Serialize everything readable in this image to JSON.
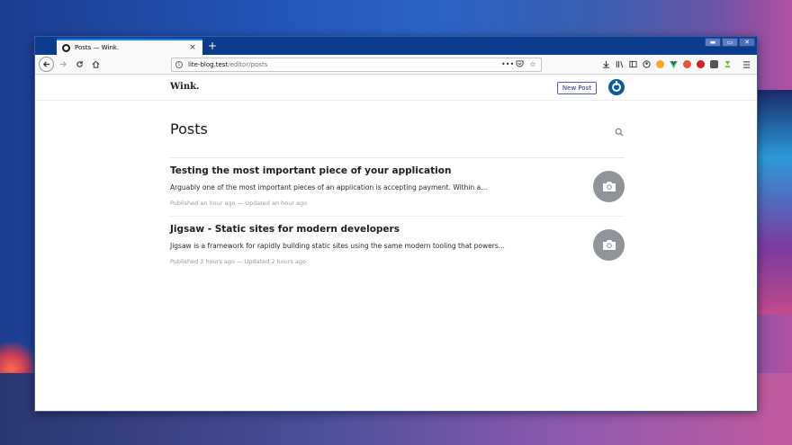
{
  "browser": {
    "tab_title": "Posts — Wink.",
    "tab_close": "×",
    "new_tab": "+",
    "window_controls": {
      "minimize": "▬",
      "maximize": "▭",
      "close": "✕"
    },
    "url_host": "lite-blog.test",
    "url_path": "/editor/posts",
    "url_more": "•••"
  },
  "app": {
    "logo": "Wink.",
    "new_post_label": "New Post",
    "page_title": "Posts",
    "posts": [
      {
        "title": "Testing the most important piece of your application",
        "excerpt": "Arguably one of the most important pieces of an application is accepting payment. Within a...",
        "meta": "Published an hour ago — Updated an hour ago"
      },
      {
        "title": "Jigsaw - Static sites for modern developers",
        "excerpt": "Jigsaw is a framework for rapidly building static sites using the same modern tooling that powers...",
        "meta": "Published 2 hours ago — Updated 2 hours ago"
      }
    ]
  },
  "colors": {
    "accent": "#0a84ff",
    "avatar": "#0a5aa8",
    "new_post_border": "#5a5ab8",
    "thumb": "#8f949b"
  },
  "icons": {
    "extensions": [
      "ublock-icon",
      "vue-icon",
      "honey-icon",
      "lastpass-icon",
      "db-icon",
      "download-icon"
    ]
  }
}
